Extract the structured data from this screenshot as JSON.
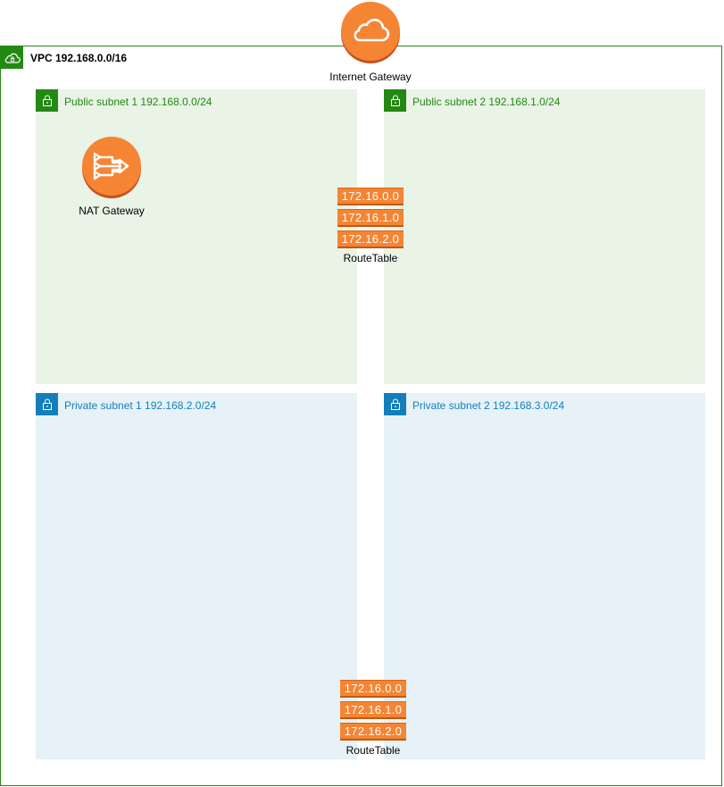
{
  "vpc": {
    "label": "VPC 192.168.0.0/16"
  },
  "internet_gateway": {
    "label": "Internet Gateway"
  },
  "nat_gateway": {
    "label": "NAT Gateway"
  },
  "subnets": {
    "public_1": "Public subnet 1 192.168.0.0/24",
    "public_2": "Public subnet 2 192.168.1.0/24",
    "private_1": "Private subnet 1 192.168.2.0/24",
    "private_2": "Private subnet 2 192.168.3.0/24"
  },
  "route_tables": [
    {
      "entries": [
        "172.16.0.0",
        "172.16.1.0",
        "172.16.2.0"
      ],
      "label": "RouteTable"
    },
    {
      "entries": [
        "172.16.0.0",
        "172.16.1.0",
        "172.16.2.0"
      ],
      "label": "RouteTable"
    }
  ],
  "colors": {
    "vpc_border": "#248814",
    "public_fill": "#e9f3e6",
    "private_fill": "#e6f2f8",
    "private_accent": "#147eba",
    "aws_orange": "#f58534"
  }
}
